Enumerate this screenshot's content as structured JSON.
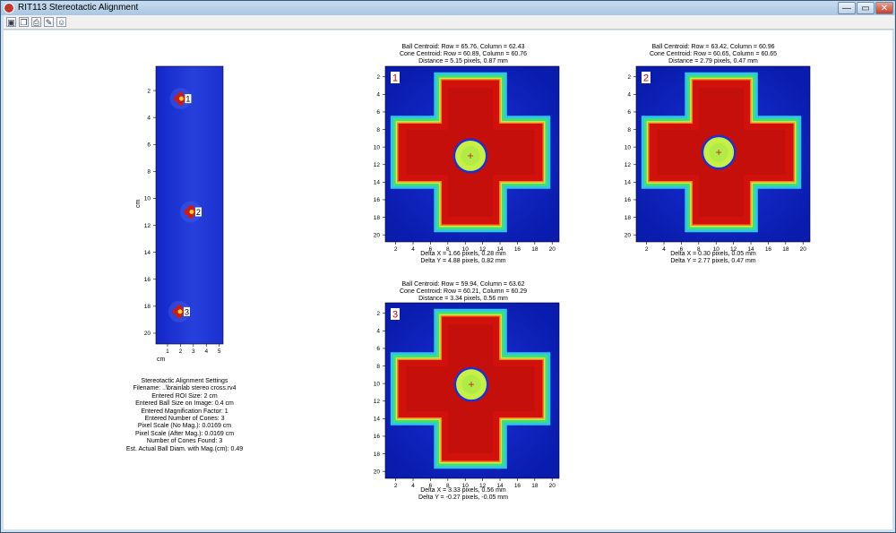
{
  "window": {
    "title": "RIT113 Stereotactic Alignment",
    "min_glyph": "—",
    "max_glyph": "▭",
    "close_glyph": "✕"
  },
  "toolbar": [
    {
      "name": "save-icon",
      "glyph": "▣"
    },
    {
      "name": "copy-icon",
      "glyph": "❐"
    },
    {
      "name": "print-icon",
      "glyph": "⎙"
    },
    {
      "name": "edit-icon",
      "glyph": "✎"
    },
    {
      "name": "people-icon",
      "glyph": "☺"
    }
  ],
  "overview": {
    "x_ticks": [
      "1",
      "2",
      "3",
      "4",
      "5"
    ],
    "y_ticks": [
      "2",
      "4",
      "6",
      "8",
      "10",
      "12",
      "14",
      "16",
      "18",
      "20"
    ],
    "xlabel": "cm",
    "ylabel": "cm",
    "markers": [
      "1",
      "2",
      "3"
    ]
  },
  "panels": [
    {
      "label": "1",
      "header": [
        "Ball Centroid: Row = 65.76, Column = 62.43",
        "Cone Centroid: Row = 60.89, Column = 60.76",
        "Distance = 5.15 pixels, 0.87 mm"
      ],
      "footer": [
        "Delta X = 1.66 pixels, 0.28 mm",
        "Delta Y = 4.88 pixels, 0.82 mm"
      ],
      "ball": {
        "x": 10.6,
        "y": 11.0
      }
    },
    {
      "label": "2",
      "header": [
        "Ball Centroid: Row = 63.42, Column = 60.96",
        "Cone Centroid: Row = 60.65, Column = 60.65",
        "Distance = 2.79 pixels, 0.47 mm"
      ],
      "footer": [
        "Delta X = 0.30 pixels, 0.05 mm",
        "Delta Y = 2.77 pixels, 0.47 mm"
      ],
      "ball": {
        "x": 10.3,
        "y": 10.6
      }
    },
    {
      "label": "3",
      "header": [
        "Ball Centroid: Row = 59.94, Column = 63.62",
        "Cone Centroid: Row = 60.21, Column = 60.29",
        "Distance = 3.34 pixels, 0.56 mm"
      ],
      "footer": [
        "Delta X = 3.33 pixels, 0.56 mm",
        "Delta Y = -0.27 pixels, -0.05 mm"
      ],
      "ball": {
        "x": 10.7,
        "y": 10.1
      }
    }
  ],
  "panel_ticks": [
    "2",
    "4",
    "6",
    "8",
    "10",
    "12",
    "14",
    "16",
    "18",
    "20"
  ],
  "settings": [
    "Stereotactic Alignment Settings",
    "Filename: ..\\brainlab stereo cross.rv4",
    "Entered ROI Size: 2 cm",
    "Entered Ball Size on Image: 0.4 cm",
    "Entered Magnification Factor: 1",
    "Entered Number of Cones: 3",
    "Pixel Scale (No Mag.): 0.0169 cm",
    "Pixel Scale (After Mag.): 0.0169 cm",
    "Number of Cones Found: 3",
    "Est. Actual Ball Diam. with Mag.(cm): 0.49"
  ]
}
